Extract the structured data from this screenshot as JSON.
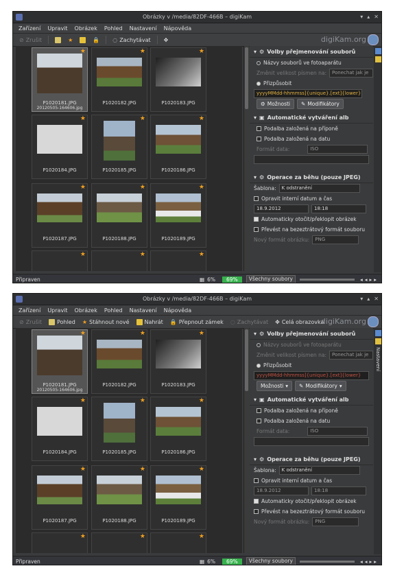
{
  "window": {
    "title": "Obrázky v /media/82DF-466B – digiKam",
    "menu": [
      "Zařízení",
      "Upravit",
      "Obrázek",
      "Pohled",
      "Nastavení",
      "Nápověda"
    ],
    "brand": "digiKam.org"
  },
  "top_toolbar": [
    "Zrušit",
    "Pohled",
    "Stáhnout nové",
    "Nahrát",
    "Přepnout zámek",
    "Zachytávat",
    "Celá obrazovka"
  ],
  "bottom_toolbar": [
    "Zrušit",
    "Pohled",
    "Stáhnout nové",
    "Nahrát",
    "Přepnout zámek",
    "Zachytávat",
    "Celá obrazovka"
  ],
  "thumbs": [
    {
      "name": "P1020181.JPG",
      "sub": "20120505-164606.jpg"
    },
    {
      "name": "P1020182.JPG",
      "sub": ""
    },
    {
      "name": "P1020183.JPG",
      "sub": ""
    },
    {
      "name": "P1020184.JPG",
      "sub": ""
    },
    {
      "name": "P1020185.JPG",
      "sub": ""
    },
    {
      "name": "P1020186.JPG",
      "sub": ""
    },
    {
      "name": "P1020187.JPG",
      "sub": ""
    },
    {
      "name": "P1020188.JPG",
      "sub": ""
    },
    {
      "name": "P1020189.JPG",
      "sub": ""
    }
  ],
  "panel": {
    "rename_header": "Volby přejmenování souborů",
    "camera_names": "Názvy souborů ve fotoaparátu",
    "change_case": "Změnit velikost písmen na:",
    "case_value": "Ponechat jak je",
    "customize": "Přizpůsobit",
    "pattern": "yyyyMMdd-hhmmss]{unique}.[ext]{lower}",
    "options": "Možnosti",
    "modifiers": "Modifikátory",
    "album_header": "Automatické vytváření alb",
    "by_ext": "Podalba založená na příponě",
    "by_date": "Podalba založená na datu",
    "date_format_label": "Formát data:",
    "date_format_value": "ISO",
    "ops_header": "Operace za běhu (pouze JPEG)",
    "template_label": "Šablona:",
    "template_value": "K odstranění",
    "fix_date": "Opravit interní datum a čas",
    "date_value": "18.9.2012",
    "time_value": "18:18",
    "auto_rotate": "Automaticky otočit/překlopit obrázek",
    "convert": "Převést na bezeztrátový formát souboru",
    "new_format_label": "Nový formát obrázku:",
    "new_format_value": "PNG",
    "side_tab": "Nastavení"
  },
  "status": {
    "ready": "Připraven",
    "percent": "6%",
    "progress_label": "69%",
    "filter": "Všechny soubory"
  },
  "colors": {
    "accent": "#f0a020",
    "progress": "#37b24d",
    "bg": "#3a3b3d"
  }
}
